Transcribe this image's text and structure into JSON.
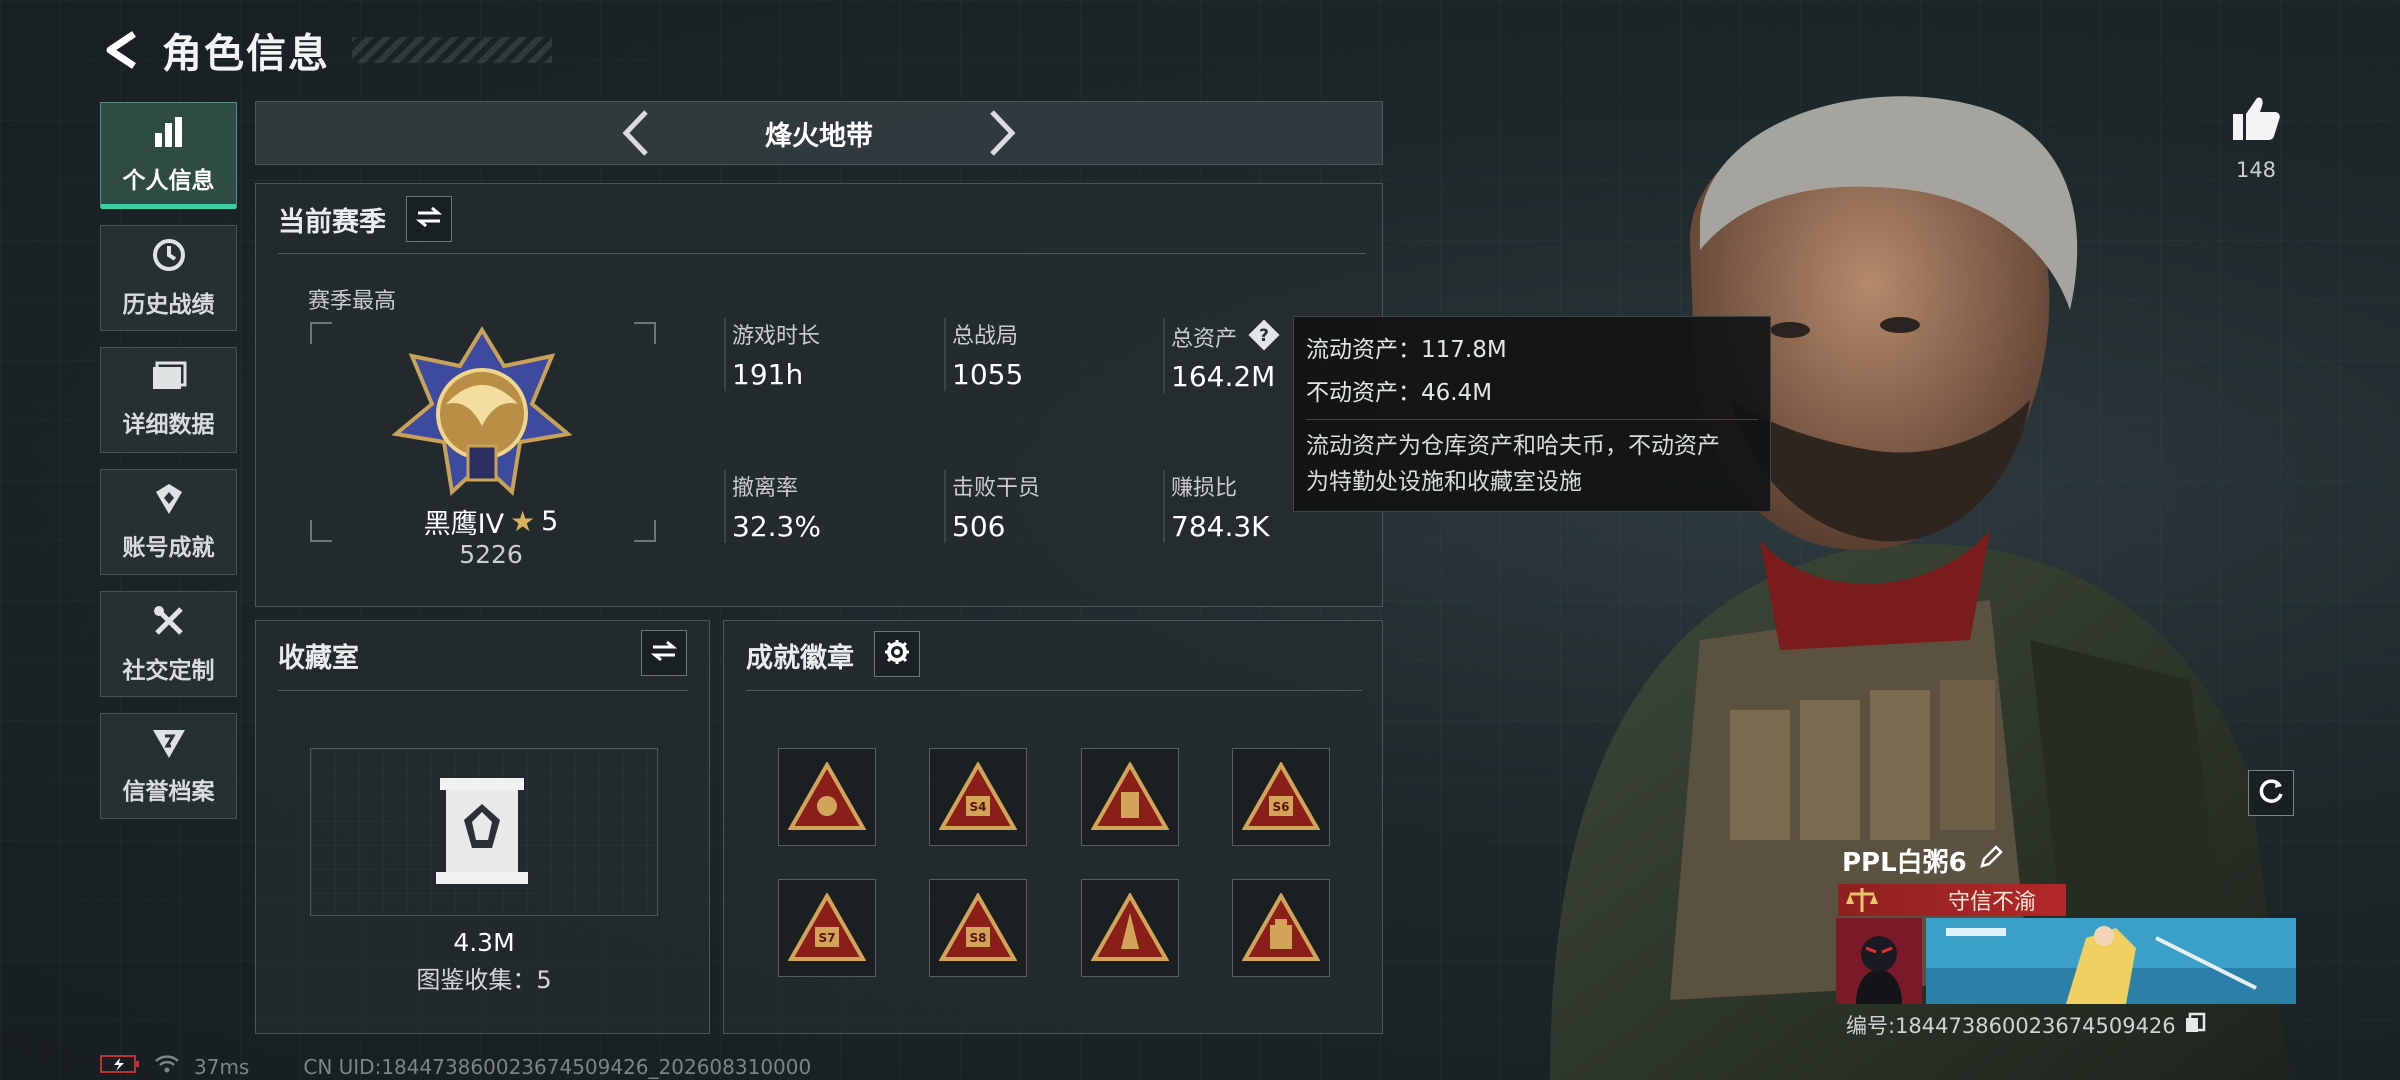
{
  "header": {
    "title": "角色信息"
  },
  "sidebar": {
    "items": [
      {
        "label": "个人信息",
        "icon": "bar-chart-icon",
        "active": true
      },
      {
        "label": "历史战绩",
        "icon": "history-clock-icon"
      },
      {
        "label": "详细数据",
        "icon": "folder-icon"
      },
      {
        "label": "账号成就",
        "icon": "achievement-icon"
      },
      {
        "label": "社交定制",
        "icon": "tools-icon"
      },
      {
        "label": "信誉档案",
        "icon": "credit-shield-icon"
      }
    ]
  },
  "map_selector": {
    "name": "烽火地带"
  },
  "season": {
    "title": "当前赛季",
    "best_label": "赛季最高",
    "rank_name": "黑鹰IV",
    "rank_stars": "5",
    "rank_points": "5226",
    "stats": [
      {
        "label": "游戏时长",
        "value": "191h"
      },
      {
        "label": "总战局",
        "value": "1055"
      },
      {
        "label": "总资产",
        "value": "164.2M"
      },
      {
        "label": "撤离率",
        "value": "32.3%"
      },
      {
        "label": "击败干员",
        "value": "506"
      },
      {
        "label": "赚损比",
        "value": "784.3K"
      }
    ]
  },
  "tooltip": {
    "liquid": "流动资产：117.8M",
    "fixed": "不动资产：46.4M",
    "desc_line1": "流动资产为仓库资产和哈夫币，不动资产",
    "desc_line2": "为特勤处设施和收藏室设施"
  },
  "collection": {
    "title": "收藏室",
    "value": "4.3M",
    "count_label": "图鉴收集：5"
  },
  "achievements": {
    "title": "成就徽章",
    "badges": [
      "",
      "S4",
      "",
      "S6",
      "S7",
      "S8",
      "",
      ""
    ]
  },
  "likes": {
    "count": "148"
  },
  "player": {
    "name": "PPL白粥6",
    "title": "守信不渝",
    "id_label": "编号:184473860023674509426"
  },
  "status_bar": {
    "ping": "37ms",
    "uid": "CN UID:184473860023674509426_202608310000"
  },
  "colors": {
    "accent": "#3bd1a3",
    "gold": "#c9a25a",
    "title_red": "#b32828"
  }
}
